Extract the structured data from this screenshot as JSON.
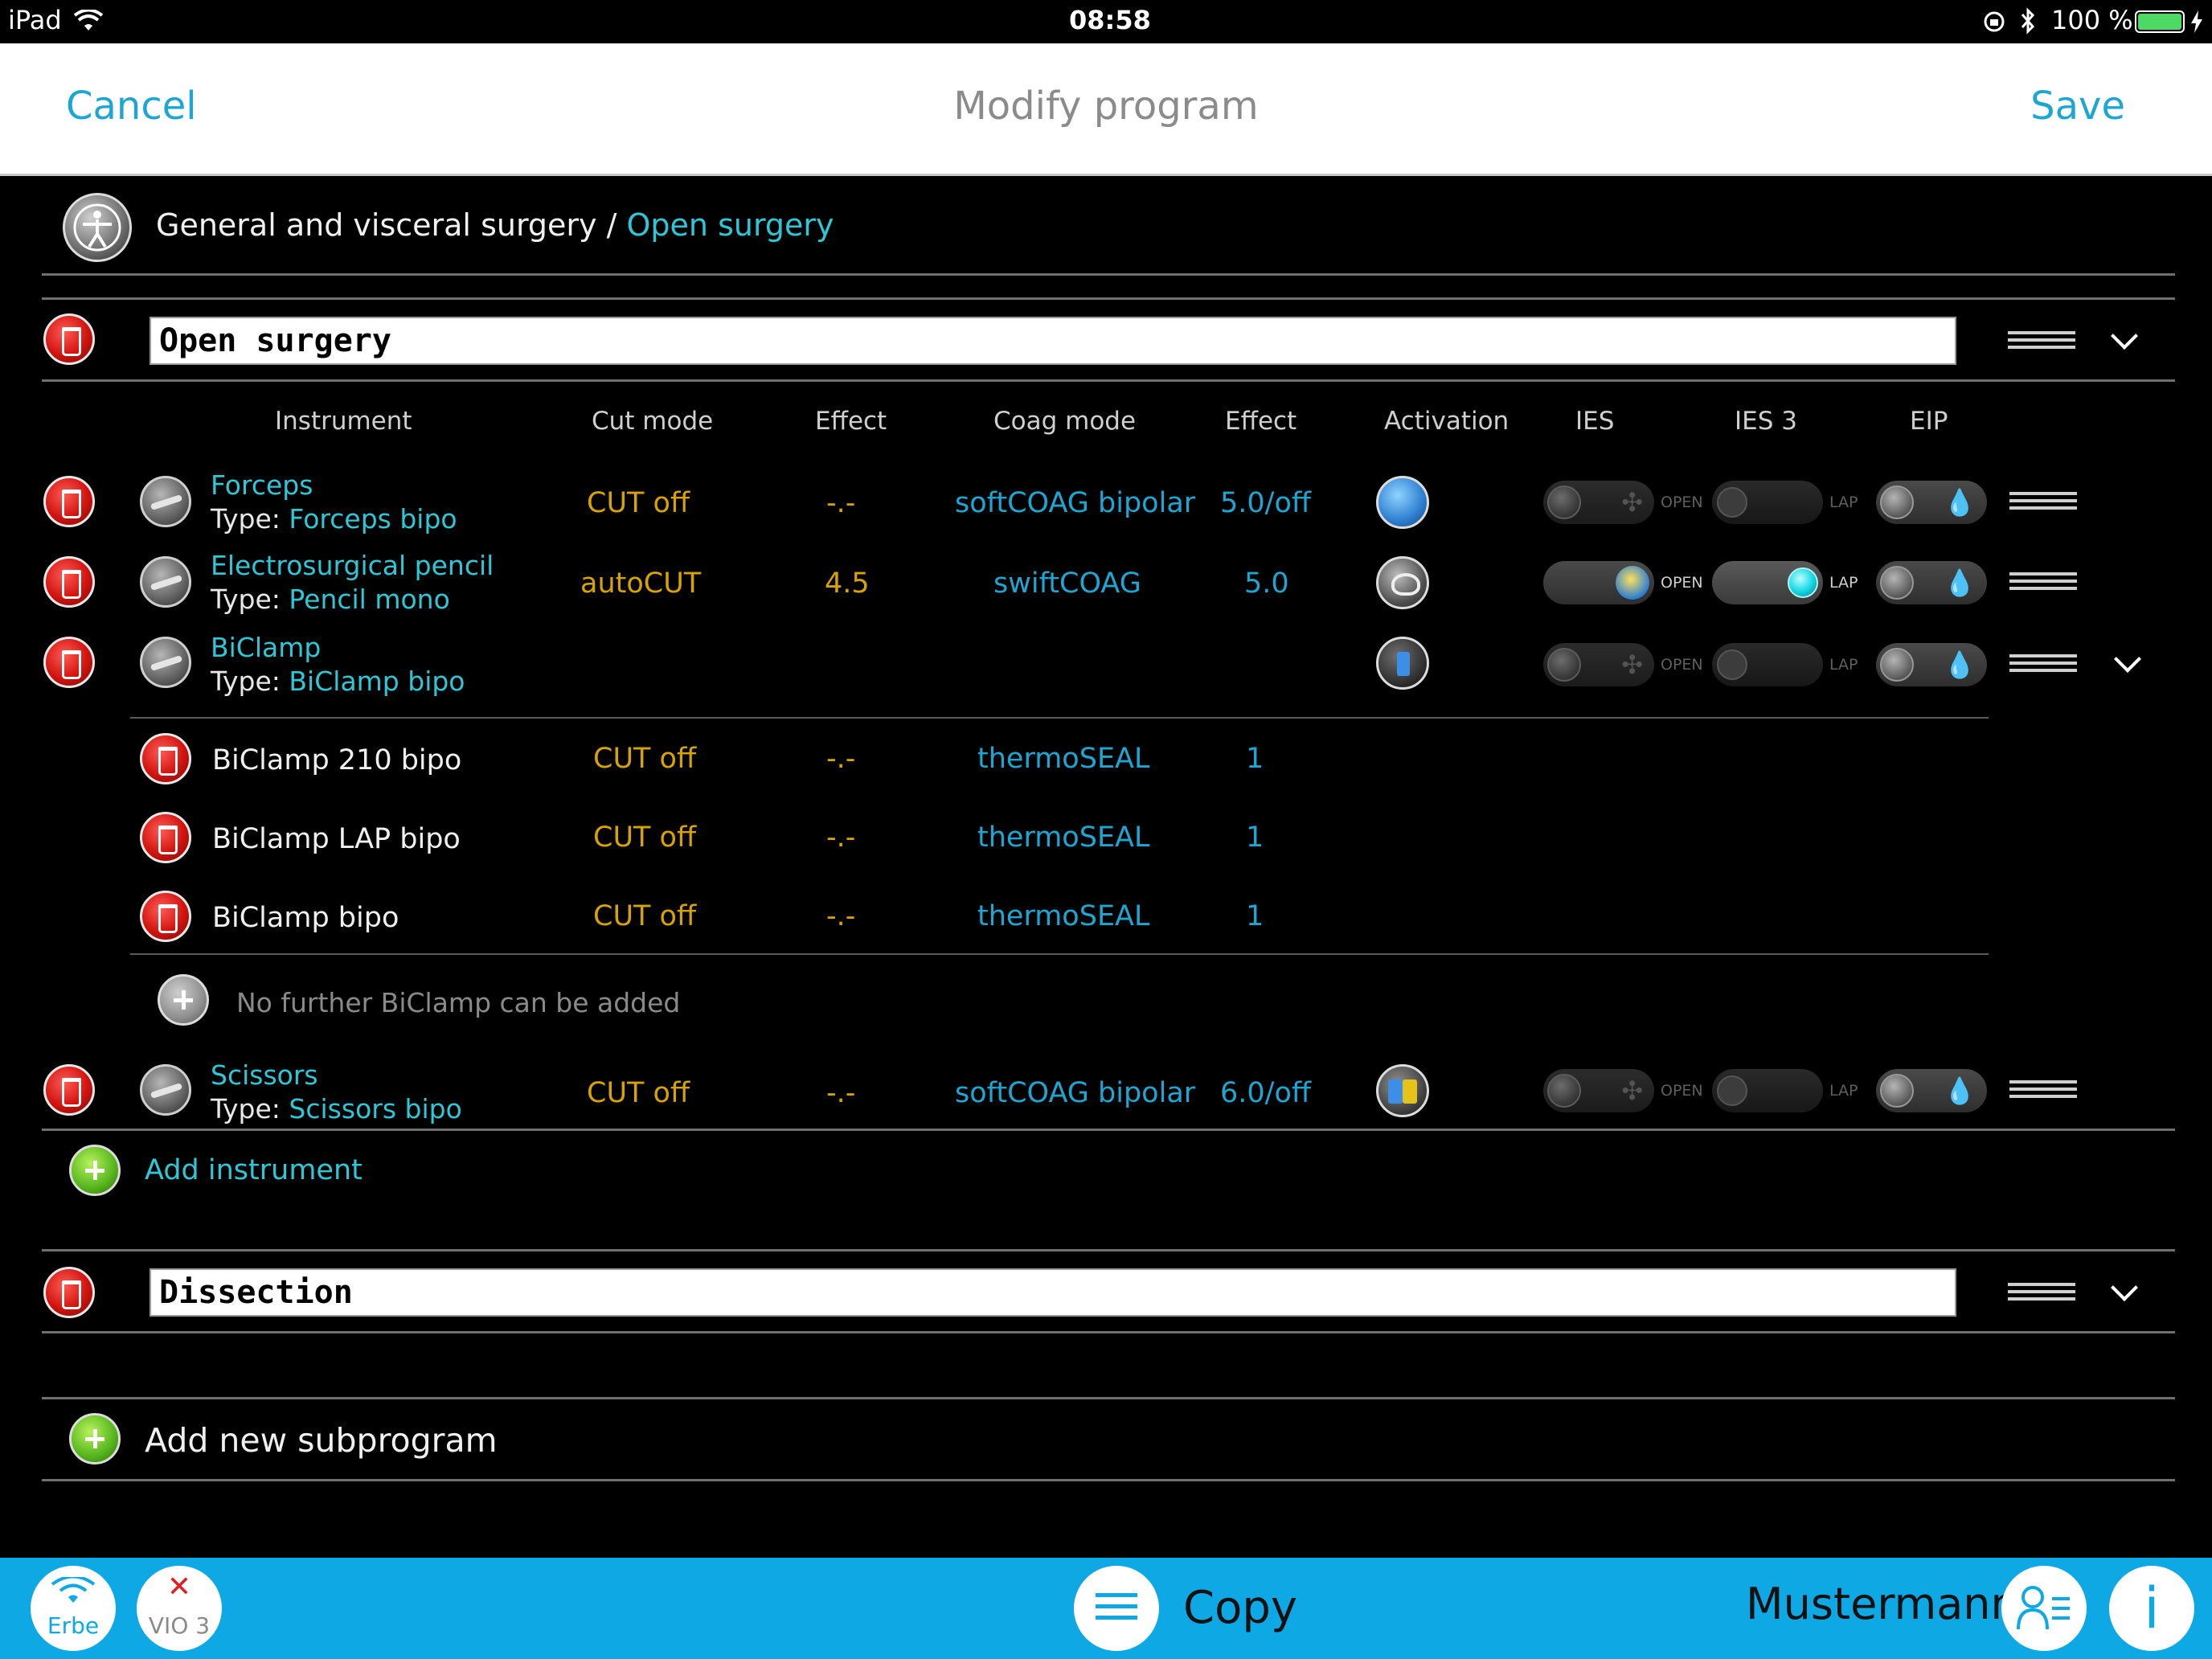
{
  "status_bar": {
    "device": "iPad",
    "time": "08:58",
    "battery": "100 %"
  },
  "nav": {
    "cancel": "Cancel",
    "title": "Modify program",
    "save": "Save"
  },
  "breadcrumb": {
    "specialty": "General and visceral surgery",
    "separator": "/",
    "current": "Open surgery"
  },
  "subprograms": [
    {
      "name": "Open surgery"
    },
    {
      "name": "Dissection"
    }
  ],
  "columns": [
    "Instrument",
    "Cut mode",
    "Effect",
    "Coag mode",
    "Effect",
    "Activation",
    "IES",
    "IES 3",
    "EIP"
  ],
  "instruments": [
    {
      "name": "Forceps",
      "type_prefix": "Type:",
      "type": "Forceps bipo",
      "cut_mode": "CUT off",
      "cut_effect": "-.-",
      "coag_mode": "softCOAG bipolar",
      "coag_effect": "5.0/off",
      "activation": "start-button",
      "ies": "off",
      "ies3": "off",
      "eip": "off"
    },
    {
      "name": "Electrosurgical pencil",
      "type_prefix": "Type:",
      "type": "Pencil mono",
      "cut_mode": "autoCUT",
      "cut_effect": "4.5",
      "coag_mode": "swiftCOAG",
      "coag_effect": "5.0",
      "activation": "pencil",
      "ies": "on",
      "ies3": "on",
      "eip": "off"
    },
    {
      "name": "BiClamp",
      "type_prefix": "Type:",
      "type": "BiClamp bipo",
      "cut_mode": "",
      "cut_effect": "",
      "coag_mode": "",
      "coag_effect": "",
      "activation": "footswitch-blue",
      "ies": "off",
      "ies3": "off",
      "eip": "off"
    },
    {
      "name": "Scissors",
      "type_prefix": "Type:",
      "type": "Scissors bipo",
      "cut_mode": "CUT off",
      "cut_effect": "-.-",
      "coag_mode": "softCOAG bipolar",
      "coag_effect": "6.0/off",
      "activation": "footswitch-dual",
      "ies": "off",
      "ies3": "off",
      "eip": "off"
    }
  ],
  "biclamp_variants": [
    {
      "name": "BiClamp 210 bipo",
      "cut_mode": "CUT off",
      "cut_effect": "-.-",
      "coag_mode": "thermoSEAL",
      "coag_effect": "1"
    },
    {
      "name": "BiClamp LAP bipo",
      "cut_mode": "CUT off",
      "cut_effect": "-.-",
      "coag_mode": "thermoSEAL",
      "coag_effect": "1"
    },
    {
      "name": "BiClamp bipo",
      "cut_mode": "CUT off",
      "cut_effect": "-.-",
      "coag_mode": "thermoSEAL",
      "coag_effect": "1"
    }
  ],
  "toggle_labels": {
    "open": "OPEN",
    "lap": "LAP"
  },
  "biclamp_note": "No further BiClamp can be added",
  "add_instrument": "Add instrument",
  "add_subprogram": "Add new subprogram",
  "bottom_bar": {
    "wifi_label": "Erbe",
    "device_label": "VIO 3",
    "copy": "Copy",
    "user": "Mustermann",
    "info": "i"
  },
  "colors": {
    "accent": "#1ea6d2",
    "cut": "#d6a300",
    "link": "#2ec7d6",
    "bottom_bar": "#0ea9e4",
    "delete": "#d2140f",
    "add": "#55b51c"
  },
  "icons": [
    "wifi-icon",
    "bluetooth-icon",
    "battery-icon",
    "orientation-lock-icon",
    "specialty-icon",
    "delete-icon",
    "instrument-icon",
    "drag-handle-icon",
    "chevron-down-icon",
    "add-icon",
    "menu-icon",
    "user-list-icon",
    "info-icon"
  ]
}
